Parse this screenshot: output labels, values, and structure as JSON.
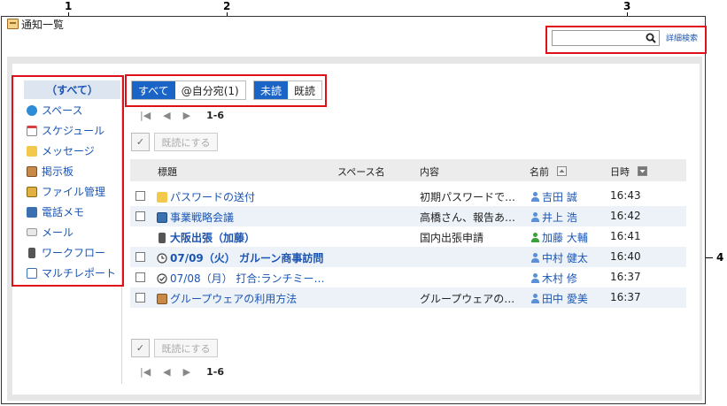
{
  "callouts": [
    "1",
    "2",
    "3",
    "4"
  ],
  "title": "通知一覧",
  "search": {
    "placeholder": "",
    "advanced_label": "詳細検索"
  },
  "sidebar": {
    "items": [
      {
        "label": "（すべて）",
        "icon": "all"
      },
      {
        "label": "スペース",
        "icon": "space-icon"
      },
      {
        "label": "スケジュール",
        "icon": "schedule-icon"
      },
      {
        "label": "メッセージ",
        "icon": "message-icon"
      },
      {
        "label": "掲示板",
        "icon": "bulletin-icon"
      },
      {
        "label": "ファイル管理",
        "icon": "file-icon"
      },
      {
        "label": "電話メモ",
        "icon": "phone-icon"
      },
      {
        "label": "メール",
        "icon": "mail-icon"
      },
      {
        "label": "ワークフロー",
        "icon": "workflow-icon"
      },
      {
        "label": "マルチレポート",
        "icon": "report-icon"
      }
    ]
  },
  "filters": {
    "all": "すべて",
    "to_me": "@自分宛(1)",
    "unread": "未読",
    "read": "既読"
  },
  "pager": {
    "first": "|◀",
    "prev": "◀",
    "next": "▶",
    "range": "1-6"
  },
  "actions": {
    "check": "✓",
    "mark_read": "既読にする"
  },
  "table": {
    "headers": {
      "subject": "標題",
      "space": "スペース名",
      "content": "内容",
      "name": "名前",
      "time": "日時"
    },
    "rows": [
      {
        "subject": "パスワードの送付",
        "content": "初期パスワードで…",
        "name": "吉田 誠",
        "time": "16:43",
        "bold": false,
        "checkbox": true,
        "icon": "message-icon",
        "user_color": "#5b8fd6"
      },
      {
        "subject": "事業戦略会議",
        "content": "高橋さん、報告あ…",
        "name": "井上 浩",
        "time": "16:42",
        "bold": false,
        "checkbox": true,
        "icon": "bulletin-icon",
        "user_color": "#5b8fd6"
      },
      {
        "subject": "大阪出張（加藤）",
        "content": "国内出張申請",
        "name": "加藤 大輔",
        "time": "16:41",
        "bold": true,
        "checkbox": false,
        "icon": "workflow-icon",
        "user_color": "#3aa03a"
      },
      {
        "subject": "07/09（火） ガルーン商事訪問",
        "content": "",
        "name": "中村 健太",
        "time": "16:40",
        "bold": true,
        "checkbox": true,
        "icon": "clock-icon",
        "user_color": "#5b8fd6"
      },
      {
        "subject": "07/08（月） 打合:ランチミー…",
        "content": "",
        "name": "木村 修",
        "time": "16:37",
        "bold": false,
        "checkbox": true,
        "icon": "clock-check-icon",
        "user_color": "#5b8fd6"
      },
      {
        "subject": "グループウェアの利用方法",
        "content": "グループウェアの…",
        "name": "田中 愛美",
        "time": "16:37",
        "bold": false,
        "checkbox": true,
        "icon": "bulletin-icon",
        "user_color": "#5b8fd6"
      }
    ]
  },
  "colors": {
    "accent": "#1a64c8",
    "link": "#1a55b4",
    "callout_box": "#e0101a"
  }
}
